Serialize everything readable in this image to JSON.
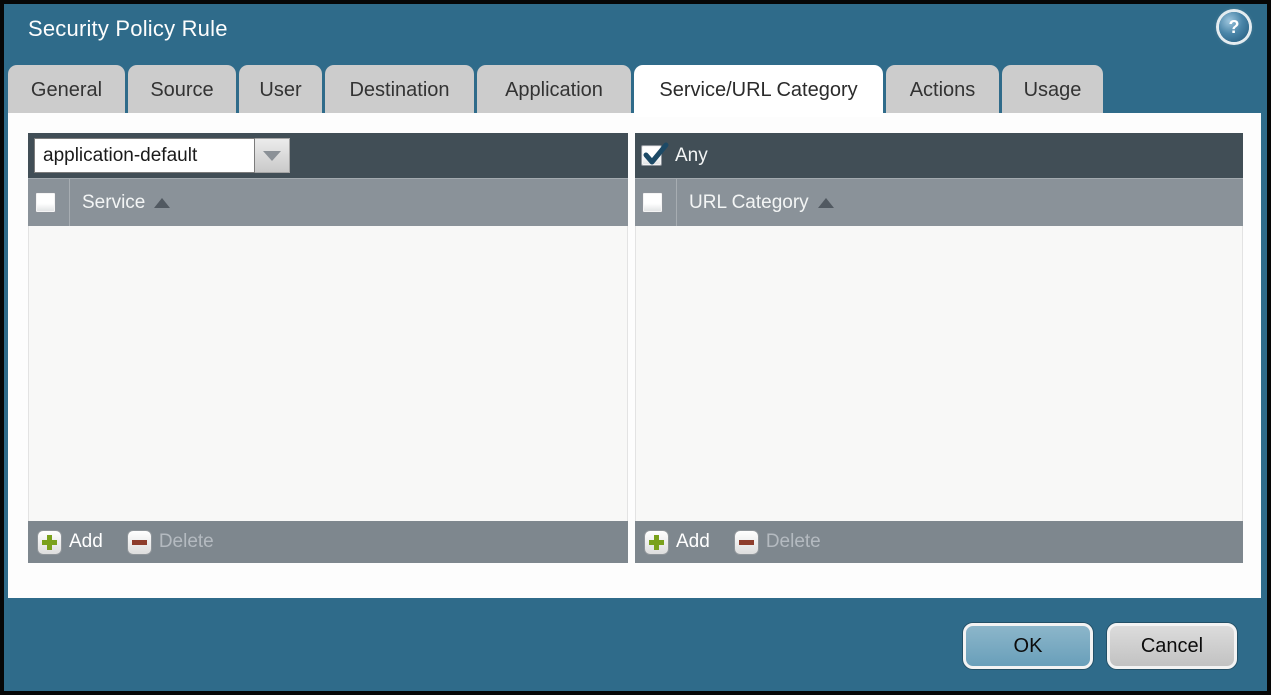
{
  "window": {
    "title": "Security Policy Rule",
    "help_icon": "?"
  },
  "tabs": [
    {
      "label": "General",
      "active": false
    },
    {
      "label": "Source",
      "active": false
    },
    {
      "label": "User",
      "active": false
    },
    {
      "label": "Destination",
      "active": false
    },
    {
      "label": "Application",
      "active": false
    },
    {
      "label": "Service/URL Category",
      "active": true
    },
    {
      "label": "Actions",
      "active": false
    },
    {
      "label": "Usage",
      "active": false
    }
  ],
  "service_panel": {
    "selector_value": "application-default",
    "column_header": "Service",
    "sort_icon": "sort-ascending-triangle",
    "header_checkbox_checked": false,
    "rows": [],
    "add_label": "Add",
    "delete_label": "Delete",
    "delete_enabled": false
  },
  "url_category_panel": {
    "any_label": "Any",
    "any_checked": true,
    "column_header": "URL Category",
    "sort_icon": "sort-ascending-triangle",
    "header_checkbox_checked": false,
    "rows": [],
    "add_label": "Add",
    "delete_label": "Delete",
    "delete_enabled": false
  },
  "footer": {
    "ok_label": "OK",
    "cancel_label": "Cancel"
  },
  "colors": {
    "dialog_background": "#2F6B8A",
    "panel_top_bar": "#414E56",
    "panel_header_bar": "#8A9299",
    "panel_footer_bar": "#7E878E",
    "panel_body": "#F8F8F7",
    "tab_inactive": "#CCCCCC",
    "tab_active": "#FFFFFF",
    "ok_button": "#74A7C0",
    "cancel_button": "#CFCFCF",
    "add_plus_green": "#7AA11C",
    "delete_minus_red": "#8E3D2C",
    "checkmark_blue": "#1D4A66"
  }
}
